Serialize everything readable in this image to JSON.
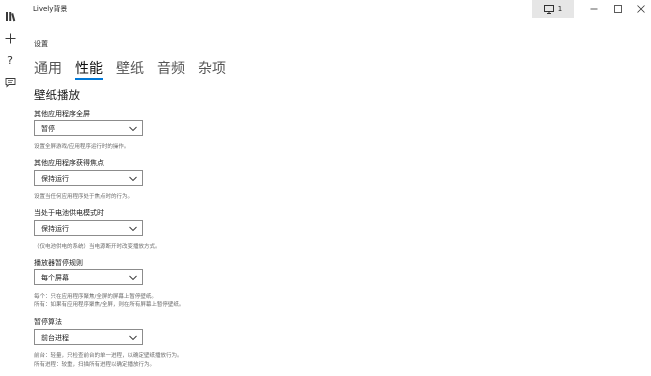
{
  "app": {
    "title": "Lively背景",
    "monitor_count": "1"
  },
  "sidebar": {
    "icons": [
      "library-icon",
      "add-icon",
      "help-icon",
      "feedback-icon"
    ],
    "help_glyph": "?"
  },
  "settings": {
    "heading": "设置",
    "tabs": [
      {
        "label": "通用"
      },
      {
        "label": "性能"
      },
      {
        "label": "壁纸"
      },
      {
        "label": "音频"
      },
      {
        "label": "杂项"
      }
    ],
    "active_tab": "性能",
    "section_title": "壁纸播放",
    "fields": [
      {
        "label": "其他应用程序全屏",
        "value": "暂停",
        "description": [
          "设置全屏游戏/应用程序运行时的操作。"
        ]
      },
      {
        "label": "其他应用程序获得焦点",
        "value": "保持运行",
        "description": [
          "设置当任何应用程序处于焦点时的行为。"
        ]
      },
      {
        "label": "当处于电池供电模式时",
        "value": "保持运行",
        "description": [
          "（仅电池供电的系统）当电源断开时改变播放方式。"
        ]
      },
      {
        "label": "播放器暂停规则",
        "value": "每个屏幕",
        "description": [
          "每个：只在应用程序聚焦/全屏的屏幕上暂停壁纸。",
          "所有：如果有应用程序聚焦/全屏，则在所有屏幕上暂停壁纸。"
        ]
      },
      {
        "label": "暂停算法",
        "value": "前台进程",
        "description": [
          "前台：轻量，只检查前台的单一进程，以确定壁纸播放行为。",
          "所有进程：较重，扫描所有进程以确定播放行为。"
        ]
      }
    ]
  },
  "colors": {
    "active_tab_underline": "#0078d7",
    "monitor_button_bg": "#e6e6e6",
    "dropdown_border": "#8c8c8c"
  }
}
